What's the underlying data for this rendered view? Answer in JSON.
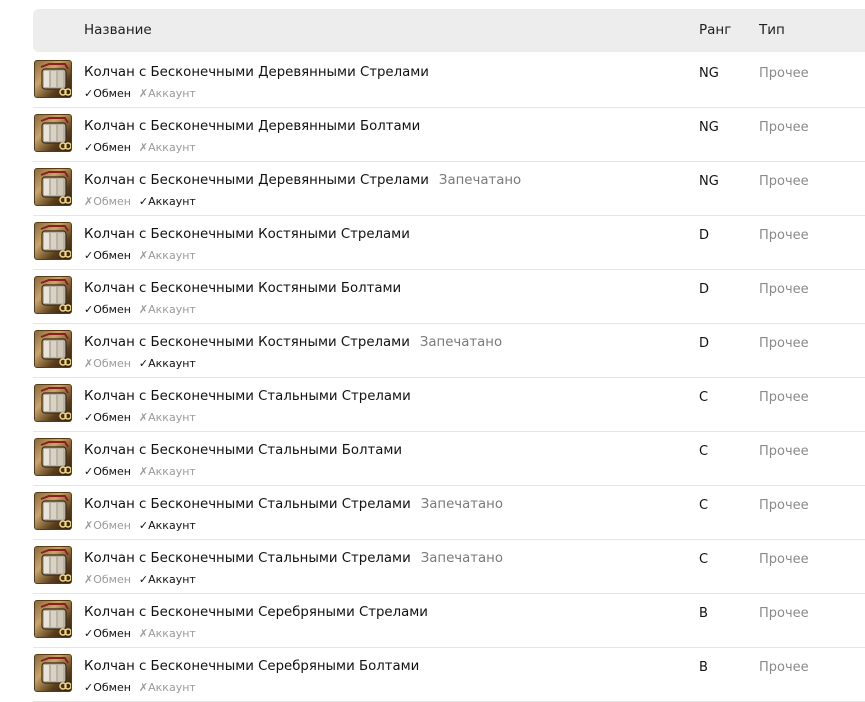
{
  "header": {
    "name": "Название",
    "rank": "Ранг",
    "type": "Тип"
  },
  "rows": [
    {
      "title": "Колчан с Бесконечными Деревянными Стрелами",
      "sealed": "",
      "exchange": "✓Обмен",
      "exchange_on": true,
      "account": "✗Аккаунт",
      "account_on": false,
      "rank": "NG",
      "type": "Прочее"
    },
    {
      "title": "Колчан с Бесконечными Деревянными Болтами",
      "sealed": "",
      "exchange": "✓Обмен",
      "exchange_on": true,
      "account": "✗Аккаунт",
      "account_on": false,
      "rank": "NG",
      "type": "Прочее"
    },
    {
      "title": "Колчан с Бесконечными Деревянными Стрелами",
      "sealed": "Запечатано",
      "exchange": "✗Обмен",
      "exchange_on": false,
      "account": "✓Аккаунт",
      "account_on": true,
      "rank": "NG",
      "type": "Прочее"
    },
    {
      "title": "Колчан с Бесконечными Костяными Стрелами",
      "sealed": "",
      "exchange": "✓Обмен",
      "exchange_on": true,
      "account": "✗Аккаунт",
      "account_on": false,
      "rank": "D",
      "type": "Прочее"
    },
    {
      "title": "Колчан с Бесконечными Костяными Болтами",
      "sealed": "",
      "exchange": "✓Обмен",
      "exchange_on": true,
      "account": "✗Аккаунт",
      "account_on": false,
      "rank": "D",
      "type": "Прочее"
    },
    {
      "title": "Колчан с Бесконечными Костяными Стрелами",
      "sealed": "Запечатано",
      "exchange": "✗Обмен",
      "exchange_on": false,
      "account": "✓Аккаунт",
      "account_on": true,
      "rank": "D",
      "type": "Прочее"
    },
    {
      "title": "Колчан с Бесконечными Стальными Стрелами",
      "sealed": "",
      "exchange": "✓Обмен",
      "exchange_on": true,
      "account": "✗Аккаунт",
      "account_on": false,
      "rank": "C",
      "type": "Прочее"
    },
    {
      "title": "Колчан с Бесконечными Стальными Болтами",
      "sealed": "",
      "exchange": "✓Обмен",
      "exchange_on": true,
      "account": "✗Аккаунт",
      "account_on": false,
      "rank": "C",
      "type": "Прочее"
    },
    {
      "title": "Колчан с Бесконечными Стальными Стрелами",
      "sealed": "Запечатано",
      "exchange": "✗Обмен",
      "exchange_on": false,
      "account": "✓Аккаунт",
      "account_on": true,
      "rank": "C",
      "type": "Прочее"
    },
    {
      "title": "Колчан с Бесконечными Стальными Стрелами",
      "sealed": "Запечатано",
      "exchange": "✗Обмен",
      "exchange_on": false,
      "account": "✓Аккаунт",
      "account_on": true,
      "rank": "C",
      "type": "Прочее"
    },
    {
      "title": "Колчан с Бесконечными Серебряными Стрелами",
      "sealed": "",
      "exchange": "✓Обмен",
      "exchange_on": true,
      "account": "✗Аккаунт",
      "account_on": false,
      "rank": "B",
      "type": "Прочее"
    },
    {
      "title": "Колчан с Бесконечными Серебряными Болтами",
      "sealed": "",
      "exchange": "✓Обмен",
      "exchange_on": true,
      "account": "✗Аккаунт",
      "account_on": false,
      "rank": "B",
      "type": "Прочее"
    }
  ]
}
